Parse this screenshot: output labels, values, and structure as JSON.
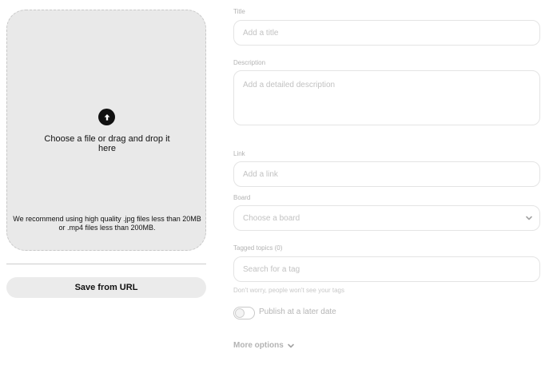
{
  "upload": {
    "prompt": "Choose a file or drag and drop it here",
    "recommendation": "We recommend using high quality .jpg files less than 20MB or .mp4 files less than 200MB.",
    "upload_icon": "arrow-up-icon"
  },
  "save_from_url": {
    "label": "Save from URL"
  },
  "form": {
    "title": {
      "label": "Title",
      "placeholder": "Add a title"
    },
    "description": {
      "label": "Description",
      "placeholder": "Add a detailed description"
    },
    "link": {
      "label": "Link",
      "placeholder": "Add a link"
    },
    "board": {
      "label": "Board",
      "placeholder": "Choose a board",
      "icon": "chevron-down-icon"
    },
    "tagged_topics": {
      "label": "Tagged topics (0)",
      "placeholder": "Search for a tag",
      "helper": "Don't worry, people won't see your tags"
    },
    "publish_later": {
      "label": "Publish at a later date",
      "on": false
    },
    "more_options": {
      "label": "More options",
      "icon": "chevron-down-icon"
    }
  },
  "colors": {
    "dropzone_bg": "#e9e9e9",
    "upload_button": "#111111",
    "border": "#e4e4e4",
    "muted_text": "#b3b3b3"
  }
}
